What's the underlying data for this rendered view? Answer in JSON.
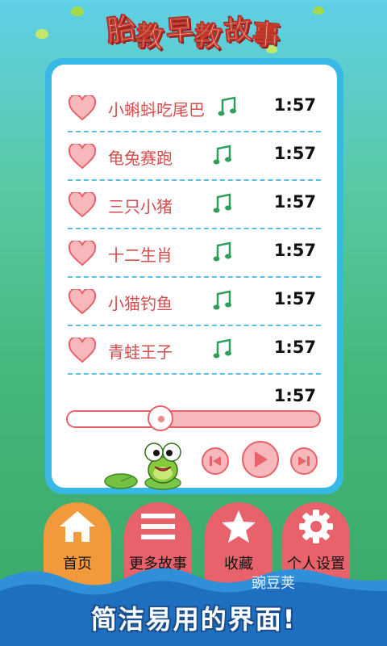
{
  "app": {
    "title_chars": [
      "胎",
      "教",
      "早",
      "教",
      "故",
      "事"
    ]
  },
  "playlist": {
    "items": [
      {
        "name": "小蝌蚪吃尾巴",
        "duration": "1:57"
      },
      {
        "name": "龟兔赛跑",
        "duration": "1:57"
      },
      {
        "name": "三只小猪",
        "duration": "1:57"
      },
      {
        "name": "十二生肖",
        "duration": "1:57"
      },
      {
        "name": "小猫钓鱼",
        "duration": "1:57"
      },
      {
        "name": "青蛙王子",
        "duration": "1:57"
      }
    ]
  },
  "player": {
    "current_time": "1:57",
    "progress_fraction": 0.37,
    "icons": {
      "prev": "skip-previous-icon",
      "play": "play-icon",
      "next": "skip-next-icon"
    }
  },
  "nav": {
    "items": [
      {
        "label": "首页",
        "icon": "home-icon",
        "color": "#f29a3b",
        "active": true
      },
      {
        "label": "更多故事",
        "icon": "list-icon",
        "color": "#e7626a"
      },
      {
        "label": "收藏",
        "icon": "star-icon",
        "color": "#e7626a"
      },
      {
        "label": "个人设置",
        "icon": "gear-icon",
        "color": "#e7626a"
      }
    ]
  },
  "footer": {
    "slogan": "简洁易用的界面!",
    "watermark": "豌豆荚"
  }
}
